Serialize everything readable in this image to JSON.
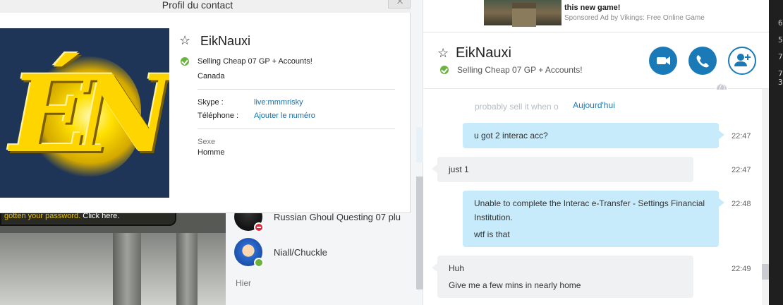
{
  "background_game": {
    "chat_text": "gotten your password.",
    "chat_link": " Click here."
  },
  "contact_list": {
    "items": [
      {
        "name": "Russian Ghoul Questing 07 plu"
      },
      {
        "name": "Niall/Chuckle"
      }
    ],
    "group_label": "Hier"
  },
  "profile": {
    "window_title": "Profil du contact",
    "name": "EikNauxi",
    "mood": "Selling Cheap 07 GP + Accounts!",
    "location": "Canada",
    "skype_label": "Skype :",
    "skype_value": "live:mmmrisky",
    "phone_label": "Téléphone :",
    "phone_value": "Ajouter le numéro",
    "sex_label": "Sexe",
    "sex_value": "Homme"
  },
  "ad": {
    "text": "this new game!",
    "sponsor": "Sponsored Ad by Vikings: Free Online Game"
  },
  "right_edge_digits": [
    "6",
    "5",
    "7",
    "7",
    "3"
  ],
  "chat": {
    "contact_name": "EikNauxi",
    "contact_mood": "Selling Cheap 07 GP + Accounts!",
    "ghost_message": "probably sell it when o",
    "day_separator": "Aujourd'hui",
    "messages": [
      {
        "direction": "out",
        "lines": [
          "u got 2 interac acc?"
        ],
        "time": "22:47"
      },
      {
        "direction": "in",
        "lines": [
          "just 1"
        ],
        "time": "22:47"
      },
      {
        "direction": "out",
        "lines": [
          "Unable to complete the Interac e-Transfer - Settings Financial Institution.",
          "wtf is that"
        ],
        "time": "22:48"
      },
      {
        "direction": "in",
        "lines": [
          "Huh",
          "Give me a few mins in nearly home"
        ],
        "time": "22:49"
      }
    ]
  },
  "colors": {
    "accent": "#1a7ab8",
    "outgoing_bubble": "#c7ebfb",
    "incoming_bubble": "#f0f1f2",
    "online": "#6cb33e",
    "busy": "#e0263a"
  }
}
